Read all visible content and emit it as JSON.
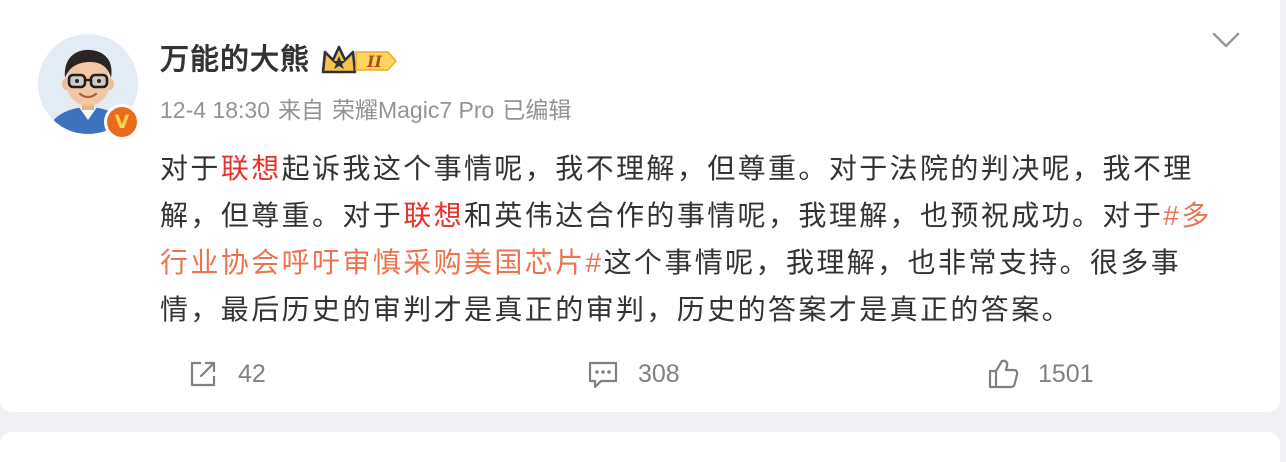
{
  "colors": {
    "page_bg": "#f1f1f3",
    "card_bg": "#ffffff",
    "text": "#333333",
    "meta": "#939393",
    "keyword": "#e5322d",
    "topic": "#eb7350",
    "verified": "#ec6a1c",
    "action": "#808080"
  },
  "post": {
    "author": {
      "name": "万能的大熊",
      "avatar_icon": "cartoon-avatar-icon",
      "verified_mark": "V",
      "member_icon": "crown-icon",
      "member_level": "II"
    },
    "more_icon": "chevron-down-icon",
    "meta": {
      "time": "12-4 18:30",
      "source_prefix": "来自",
      "source": "荣耀Magic7 Pro",
      "edited": "已编辑"
    },
    "content": {
      "segments": [
        "对于",
        "联想",
        "起诉我这个事情呢，我不理解，但尊重。对于法院的判决呢，我不理解，但尊重。对于",
        "联想",
        "和英伟达合作的事情呢，我理解，也预祝成功。对于",
        "#多行业协会呼吁审慎采购美国芯片#",
        "这个事情呢，我理解，也非常支持。很多事情，最后历史的审判才是真正的审判，历史的答案才是真正的答案。"
      ]
    },
    "actions": [
      {
        "icon": "repost-icon",
        "count": "42"
      },
      {
        "icon": "comment-icon",
        "count": "308"
      },
      {
        "icon": "like-icon",
        "count": "1501"
      }
    ]
  }
}
